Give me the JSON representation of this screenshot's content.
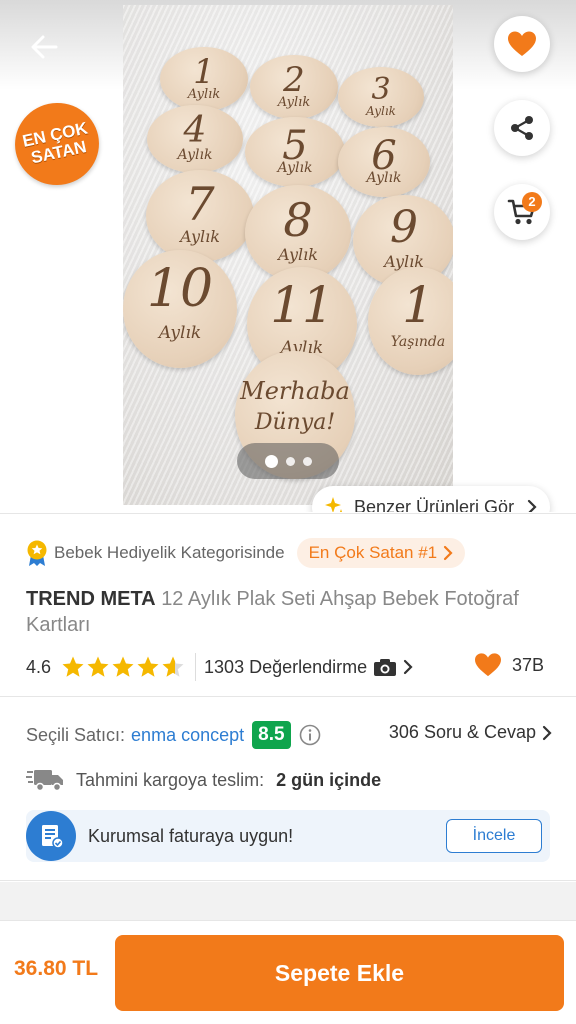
{
  "gallery": {
    "bestseller_badge": [
      "EN ÇOK",
      "SATAN"
    ],
    "discs": [
      {
        "num": "1",
        "sub": "Aylık"
      },
      {
        "num": "2",
        "sub": "Aylık"
      },
      {
        "num": "3",
        "sub": "Aylık"
      },
      {
        "num": "4",
        "sub": "Aylık"
      },
      {
        "num": "5",
        "sub": "Aylık"
      },
      {
        "num": "6",
        "sub": "Aylık"
      },
      {
        "num": "7",
        "sub": "Aylık"
      },
      {
        "num": "8",
        "sub": "Aylık"
      },
      {
        "num": "9",
        "sub": "Aylık"
      },
      {
        "num": "10",
        "sub": "Aylık"
      },
      {
        "num": "11",
        "sub": "Aylık"
      },
      {
        "num": "1",
        "sub": "Yaşında"
      },
      {
        "num": "Merhaba",
        "sub": "Dünya!"
      }
    ],
    "page_count": 3,
    "active_page": 1,
    "cart_badge": "2",
    "similar_label": "Benzer Ürünleri Gör"
  },
  "category": {
    "text": "Bebek Hediyelik Kategorisinde",
    "rank_label": "En Çok Satan #1"
  },
  "product": {
    "brand": "TREND META",
    "name": "12 Aylık Plak Seti Ahşap Bebek Fotoğraf Kartları"
  },
  "rating": {
    "value": "4.6",
    "stars": 4.6,
    "reviews": "1303 Değerlendirme",
    "favorites": "37B"
  },
  "seller": {
    "label": "Seçili Satıcı:",
    "name": "enma concept",
    "score": "8.5",
    "qa": "306 Soru & Cevap"
  },
  "shipping": {
    "label": "Tahmini kargoya teslim:",
    "value": "2 gün içinde"
  },
  "invoice": {
    "text": "Kurumsal faturaya uygun!",
    "button": "İncele"
  },
  "bottom": {
    "price": "36.80 TL",
    "add_to_cart": "Sepete Ekle"
  },
  "colors": {
    "accent": "#f27a1a",
    "seller_link": "#2d7dd2",
    "score": "#0fa54d"
  }
}
